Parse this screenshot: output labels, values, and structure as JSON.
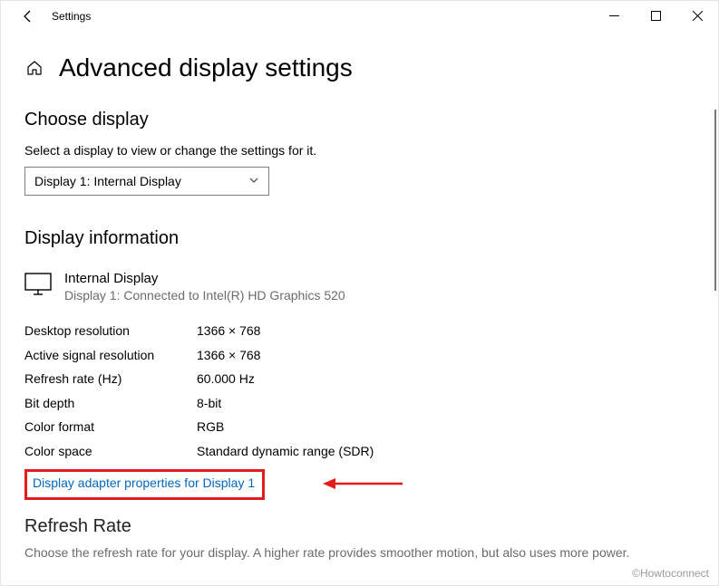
{
  "window": {
    "title": "Settings"
  },
  "page": {
    "title": "Advanced display settings"
  },
  "chooseDisplay": {
    "heading": "Choose display",
    "helper": "Select a display to view or change the settings for it.",
    "selected": "Display 1: Internal Display"
  },
  "displayInfo": {
    "heading": "Display information",
    "displayName": "Internal Display",
    "connectionLine": "Display 1: Connected to Intel(R) HD Graphics 520",
    "specs": [
      {
        "label": "Desktop resolution",
        "value": "1366 × 768"
      },
      {
        "label": "Active signal resolution",
        "value": "1366 × 768"
      },
      {
        "label": "Refresh rate (Hz)",
        "value": "60.000 Hz"
      },
      {
        "label": "Bit depth",
        "value": "8-bit"
      },
      {
        "label": "Color format",
        "value": "RGB"
      },
      {
        "label": "Color space",
        "value": "Standard dynamic range (SDR)"
      }
    ],
    "adapterLink": "Display adapter properties for Display 1"
  },
  "refreshRate": {
    "heading": "Refresh Rate",
    "desc": "Choose the refresh rate for your display. A higher rate provides smoother motion, but also uses more power."
  },
  "watermark": "©Howtoconnect"
}
